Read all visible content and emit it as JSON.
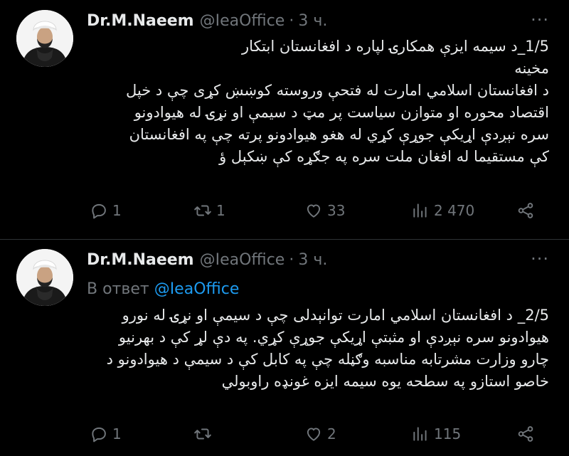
{
  "tweets": [
    {
      "author_name": "Dr.M.Naeem",
      "handle": "@IeaOffice",
      "dot": "·",
      "time": "3 ч.",
      "more": "···",
      "reply_to_prefix": "",
      "reply_to_mention": "",
      "body_lines": [
        "1/5_د سیمه ایزې همکارۍ لپاره د افغانستان ابتکار",
        "مخینه",
        "د افغانستان اسلامي امارت له فتحې وروسته کوښښ کړی چې د خپل",
        "اقتصاد محوره او متوازن سیاست پر مټ د سیمې او نړۍ له هیوادونو",
        "سره نېږدې اړیکې جوړې کړي له هغو هیوادونو پرته چې په افغانستان",
        "کې مستقیما له افغان ملت سره په جګړه کې ښکېل ؤ"
      ],
      "replies": "1",
      "retweets": "1",
      "likes": "33",
      "views": "2 470"
    },
    {
      "author_name": "Dr.M.Naeem",
      "handle": "@IeaOffice",
      "dot": "·",
      "time": "3 ч.",
      "more": "···",
      "reply_to_prefix": "В ответ",
      "reply_to_mention": "@IeaOffice",
      "body_lines": [
        "2/5_ د افغانستان اسلامي امارت توانېدلی چې د سیمې او نړۍ له نورو",
        "هیوادونو سره نېږدې او مثبتې اړیکې جوړې کړي. په دې لړ کې د بهرنیو",
        "چارو وزارت مشرتابه مناسبه وګڼله چې په کابل کې د سیمې د هیوادونو د",
        "خاصو استازو په سطحه یوه سیمه ایزه غونډه راوبولي"
      ],
      "replies": "1",
      "retweets": "",
      "likes": "2",
      "views": "115"
    }
  ],
  "icons": {
    "reply": "reply-icon",
    "retweet": "retweet-icon",
    "like": "heart-icon",
    "views": "views-icon",
    "share": "share-icon"
  },
  "colors": {
    "background": "#000000",
    "text": "#e7e9ea",
    "muted": "#71767b",
    "link": "#1d9bf0",
    "divider": "#2f3336"
  }
}
